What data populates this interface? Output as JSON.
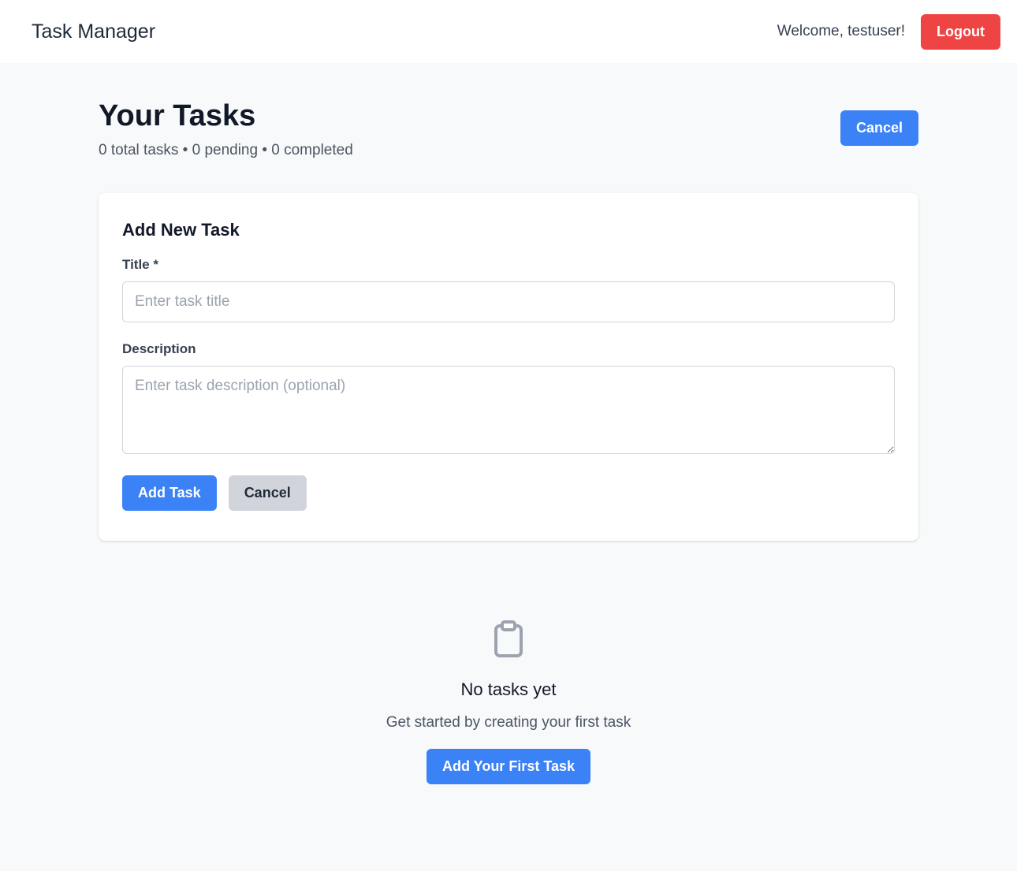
{
  "navbar": {
    "brand": "Task Manager",
    "welcome": "Welcome, testuser!",
    "logout_label": "Logout"
  },
  "header": {
    "title": "Your Tasks",
    "summary": "0 total tasks • 0 pending • 0 completed",
    "cancel_label": "Cancel"
  },
  "form": {
    "title": "Add New Task",
    "title_label": "Title *",
    "title_value": "",
    "title_placeholder": "Enter task title",
    "description_label": "Description",
    "description_value": "",
    "description_placeholder": "Enter task description (optional)",
    "submit_label": "Add Task",
    "cancel_label": "Cancel"
  },
  "empty_state": {
    "icon": "clipboard-icon",
    "title": "No tasks yet",
    "subtitle": "Get started by creating your first task",
    "button_label": "Add Your First Task"
  },
  "colors": {
    "primary": "#3b82f6",
    "danger": "#ef4444",
    "secondary": "#d1d5db",
    "background": "#f8f9fa"
  }
}
